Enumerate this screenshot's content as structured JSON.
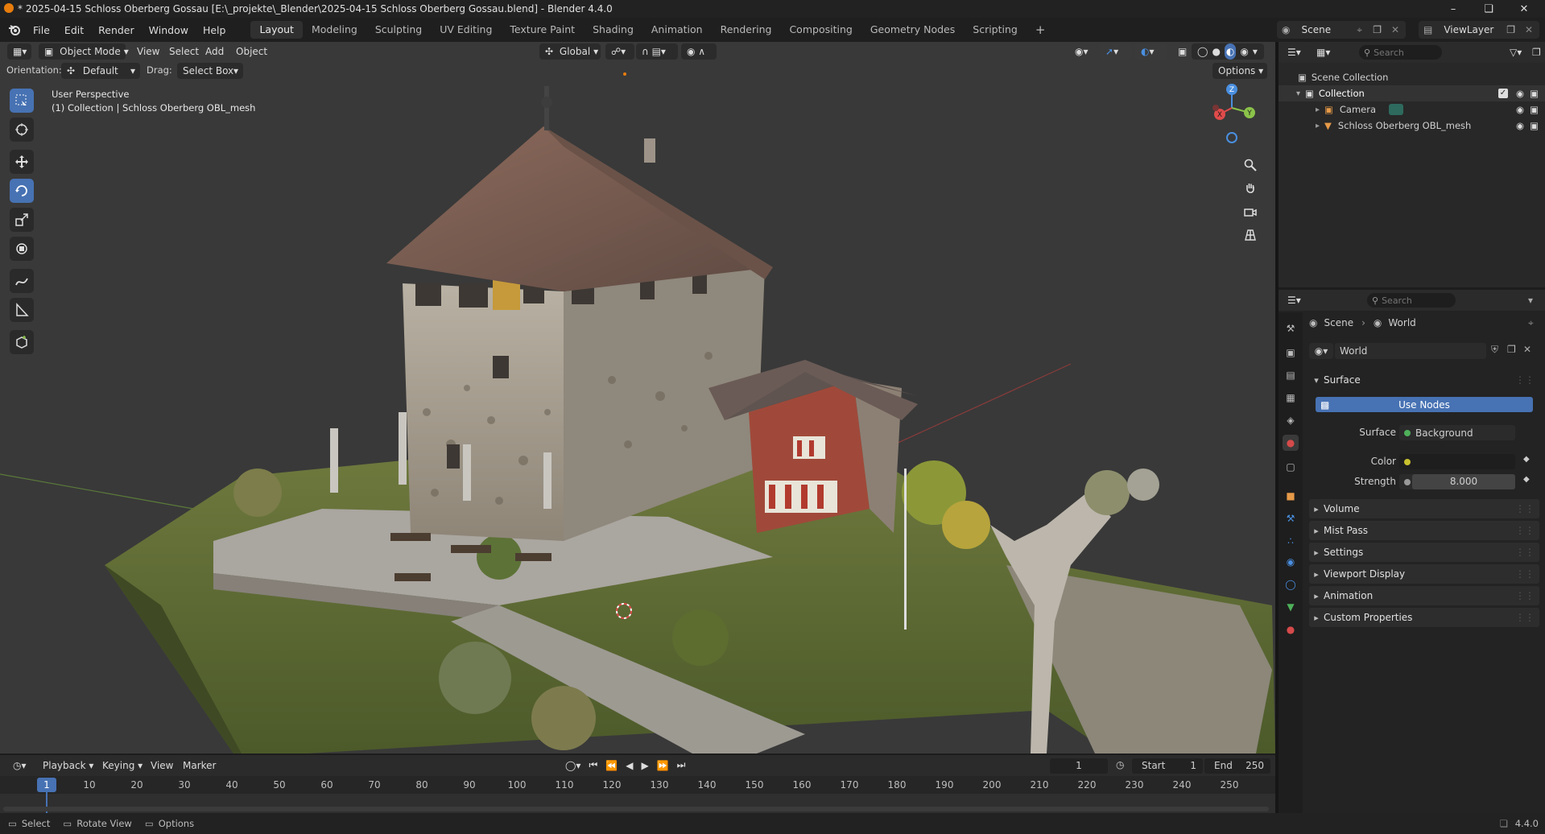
{
  "window": {
    "title": "* 2025-04-15 Schloss Oberberg Gossau [E:\\_projekte\\_Blender\\2025-04-15 Schloss Oberberg Gossau.blend] - Blender 4.4.0"
  },
  "menus": [
    "File",
    "Edit",
    "Render",
    "Window",
    "Help"
  ],
  "workspaces": [
    "Layout",
    "Modeling",
    "Sculpting",
    "UV Editing",
    "Texture Paint",
    "Shading",
    "Animation",
    "Rendering",
    "Compositing",
    "Geometry Nodes",
    "Scripting"
  ],
  "active_workspace": "Layout",
  "top_right": {
    "scene": "Scene",
    "view_layer": "ViewLayer"
  },
  "viewport": {
    "mode": "Object Mode",
    "menus": [
      "View",
      "Select",
      "Add",
      "Object"
    ],
    "orientation_label": "Orientation:",
    "orientation_value": "Default",
    "drag_label": "Drag:",
    "drag_value": "Select Box",
    "transform_space": "Global",
    "options_label": "Options",
    "overlay_line1": "User Perspective",
    "overlay_line2": "(1) Collection | Schloss Oberberg OBL_mesh",
    "gizmo": {
      "x": "X",
      "y": "Y",
      "z": "Z"
    }
  },
  "outliner": {
    "search_placeholder": "Search",
    "scene_collection": "Scene Collection",
    "collection": "Collection",
    "items": [
      "Camera",
      "Schloss Oberberg OBL_mesh"
    ]
  },
  "properties": {
    "search_placeholder": "Search",
    "breadcrumb_scene": "Scene",
    "breadcrumb_world": "World",
    "world_name": "World",
    "surface_panel": "Surface",
    "use_nodes": "Use Nodes",
    "surface_label": "Surface",
    "surface_value": "Background",
    "color_label": "Color",
    "strength_label": "Strength",
    "strength_value": "8.000",
    "panels": [
      "Volume",
      "Mist Pass",
      "Settings",
      "Viewport Display",
      "Animation",
      "Custom Properties"
    ]
  },
  "timeline": {
    "menus": [
      "Playback",
      "Keying",
      "View",
      "Marker"
    ],
    "current_frame": "1",
    "start_label": "Start",
    "start_value": "1",
    "end_label": "End",
    "end_value": "250",
    "ticks": [
      "10",
      "20",
      "30",
      "40",
      "50",
      "60",
      "70",
      "80",
      "90",
      "100",
      "110",
      "120",
      "130",
      "140",
      "150",
      "160",
      "170",
      "180",
      "190",
      "200",
      "210",
      "220",
      "230",
      "240",
      "250"
    ],
    "playhead": "1"
  },
  "statusbar": {
    "select": "Select",
    "rotate": "Rotate View",
    "options": "Options",
    "version": "4.4.0"
  },
  "colors": {
    "accent": "#4772b3",
    "x_axis": "#e04b4b",
    "y_axis": "#8bc34a",
    "z_axis": "#4a8fe0"
  }
}
